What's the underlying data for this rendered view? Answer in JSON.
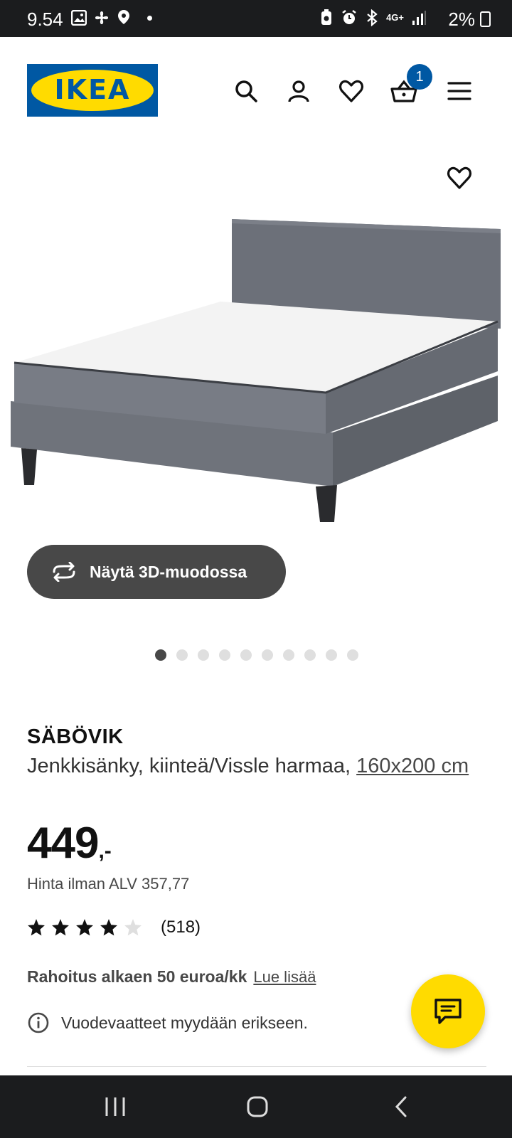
{
  "status_bar": {
    "time": "9.54",
    "battery": "2%",
    "network": "4G+"
  },
  "header": {
    "logo_text": "IKEA",
    "cart_count": "1",
    "icons": [
      "search-icon",
      "user-icon",
      "heart-icon",
      "cart-icon",
      "menu-icon"
    ]
  },
  "gallery": {
    "view_3d_label": "Näytä 3D-muodossa",
    "image_count": 10,
    "active_index": 0
  },
  "product": {
    "name": "SÄBÖVIK",
    "description": "Jenkkisänky, kiinteä/Vissle harmaa, ",
    "size": "160x200 cm",
    "price_int": "449",
    "price_dec": ",-",
    "price_vat": "Hinta ilman ALV 357,77",
    "rating_value": 4,
    "rating_max": 5,
    "review_count": "(518)",
    "finance_text": "Rahoitus alkaen 50 euroa/kk",
    "finance_link": "Lue lisää",
    "info_text": "Vuodevaatteet myydään erikseen."
  },
  "colors": {
    "ikea_blue": "#0058a3",
    "ikea_yellow": "#ffdb00",
    "dark_button": "#484848",
    "system_bar": "#1b1c1e"
  }
}
